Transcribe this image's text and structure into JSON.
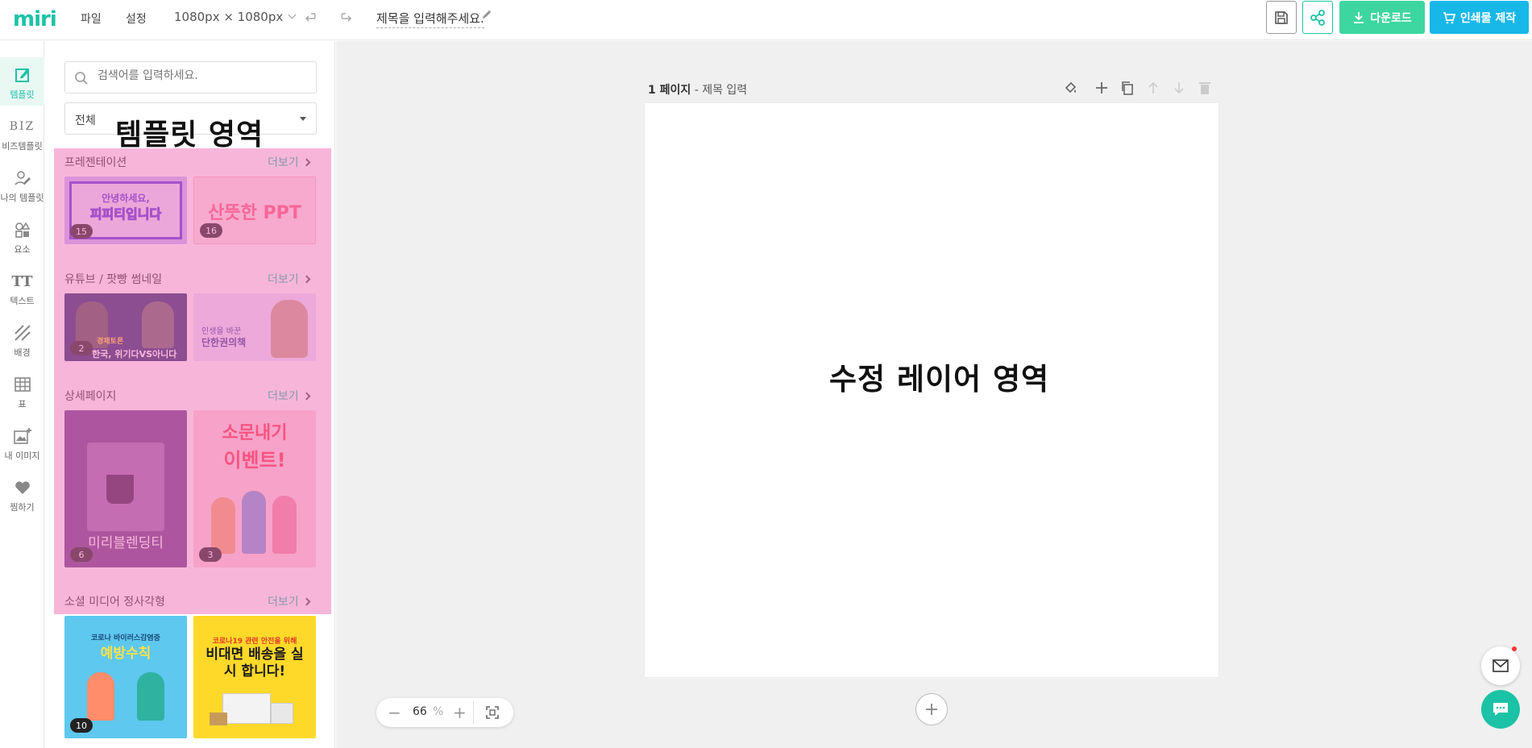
{
  "app": {
    "logo": "miri"
  },
  "header": {
    "menu_file": "파일",
    "menu_settings": "설정",
    "canvas_size": "1080px × 1080px",
    "doc_title": "제목을 입력해주세요.",
    "download_label": "다운로드",
    "print_label": "인쇄물 제작"
  },
  "rail": {
    "items": [
      {
        "label": "템플릿",
        "icon": "template-icon",
        "active": true
      },
      {
        "label": "비즈템플릿",
        "icon": "biz-icon"
      },
      {
        "label": "나의 템플릿",
        "icon": "my-template-icon"
      },
      {
        "label": "요소",
        "icon": "elements-icon"
      },
      {
        "label": "텍스트",
        "icon": "text-icon"
      },
      {
        "label": "배경",
        "icon": "background-icon"
      },
      {
        "label": "표",
        "icon": "table-icon"
      },
      {
        "label": "내 이미지",
        "icon": "image-add-icon"
      },
      {
        "label": "찜하기",
        "icon": "heart-icon"
      }
    ],
    "biz_glyph": "BIZ",
    "text_glyph": "TT",
    "collapse": "«"
  },
  "panel": {
    "search_placeholder": "검색어를 입력하세요.",
    "category_value": "전체",
    "overlay_label": "템플릿 영역",
    "more_label": "더보기",
    "sections": [
      {
        "title": "프레젠테이션",
        "thumbs": [
          {
            "badge": "15",
            "line1": "안녕하세요,",
            "line2": "피피티입니다",
            "bg": "#c7b8ff",
            "fg": "#5a34e0"
          },
          {
            "badge": "16",
            "line1": "산뜻한 PPT",
            "line2": "",
            "bg": "#ffe6e8",
            "fg": "#ff5f7a"
          }
        ]
      },
      {
        "title": "유튜브 / 팟빵 썸네일",
        "thumbs": [
          {
            "badge": "2",
            "line1": "경제토론",
            "line2": "한국, 위기다VS아니다",
            "bg": "#2b2c6e",
            "fg": "#ffffff"
          },
          {
            "badge": "",
            "line1": "인생을 바꾼",
            "line2": "단한권의책",
            "bg": "#e8e4ff",
            "fg": "#3a3aa0"
          }
        ]
      },
      {
        "title": "상세페이지",
        "thumbs": [
          {
            "badge": "6",
            "line1": "미리블렌딩티",
            "line2": "",
            "bg": "#6b3f8a",
            "fg": "#ffffff"
          },
          {
            "badge": "3",
            "line1": "소문내기",
            "line2": "이벤트!",
            "bg": "#ffd7dd",
            "fg": "#ff3a4f"
          }
        ]
      },
      {
        "title": "소셜 미디어 정사각형",
        "thumbs": [
          {
            "badge": "10",
            "line1": "코로나 바이러스감염증",
            "line2": "예방수칙",
            "bg": "#5ec8ef",
            "fg": "#ffe14a"
          },
          {
            "badge": "",
            "line1": "코로나19 관련 안전을 위해",
            "line2": "비대면 배송을 실시 합니다!",
            "bg": "#ffd92a",
            "fg": "#1b1b1b"
          }
        ]
      }
    ]
  },
  "canvas": {
    "page_number": "1 페이지",
    "page_title": "- 제목 입력",
    "overlay_label": "수정 레이어 영역",
    "zoom_value": "66",
    "zoom_unit": "%",
    "add_page": "+"
  },
  "colors": {
    "brand": "#1cc2a5",
    "download": "#3ed6a0",
    "print": "#17b8e8",
    "overlay_pink": "#f06eb4"
  }
}
